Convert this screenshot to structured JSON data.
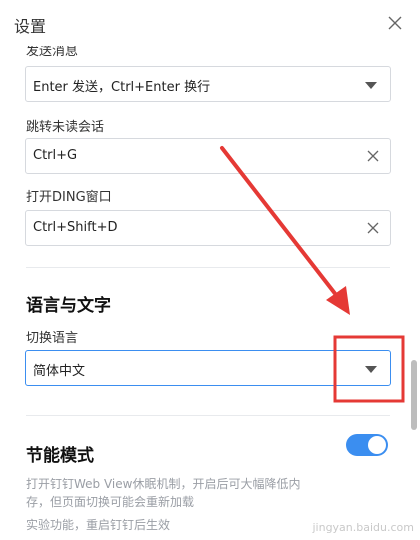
{
  "window": {
    "title": "设置"
  },
  "shortcuts": {
    "send_message": {
      "label": "发送消息",
      "value": "Enter 发送，Ctrl+Enter 换行"
    },
    "jump_unread": {
      "label": "跳转未读会话",
      "value": "Ctrl+G"
    },
    "open_ding": {
      "label": "打开DING窗口",
      "value": "Ctrl+Shift+D"
    }
  },
  "language": {
    "section_title": "语言与文字",
    "switch_label": "切换语言",
    "selected": "简体中文"
  },
  "power_saving": {
    "section_title": "节能模式",
    "description": "打开钉钉Web View休眠机制，开启后可大幅降低内存，但页面切换可能会重新加载",
    "note": "实验功能，重启钉钉后生效",
    "enabled": true
  },
  "annotation": {
    "color": "#e53935"
  },
  "watermark": "jingyan.baidu.com",
  "colors": {
    "accent": "#3b8ef0",
    "annotation": "#e53935"
  }
}
